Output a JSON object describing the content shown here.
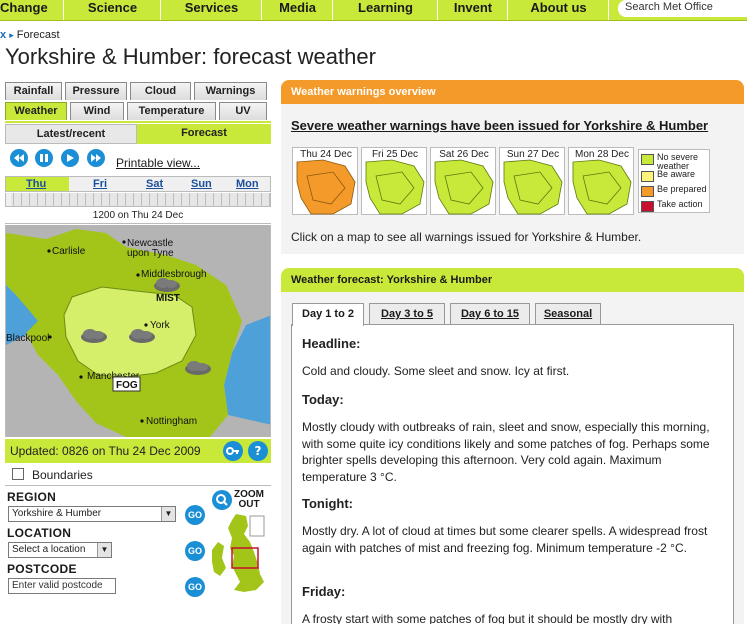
{
  "nav": {
    "items": [
      "Change",
      "Science",
      "Services",
      "Media",
      "Learning",
      "Invent",
      "About us"
    ],
    "search_placeholder": "Search Met Office"
  },
  "breadcrumb": {
    "close": "x",
    "current": "Forecast"
  },
  "page_title": "Yorkshire & Humber: forecast weather",
  "map_tabs_row1": [
    "Rainfall",
    "Pressure",
    "Cloud",
    "Warnings"
  ],
  "map_tabs_row2": [
    "Weather",
    "Wind",
    "Temperature",
    "UV"
  ],
  "active_map_tab": "Weather",
  "subtabs": {
    "latest": "Latest/recent",
    "forecast": "Forecast",
    "active": "Forecast"
  },
  "player": {
    "printable": "Printable view..."
  },
  "days": [
    "Thu",
    "Fri",
    "Sat",
    "Sun",
    "Mon"
  ],
  "selected_day": "Thu",
  "map_time": "1200 on Thu 24 Dec",
  "map_labels": {
    "carlisle": "Carlisle",
    "newcastle_1": "Newcastle",
    "newcastle_2": "upon Tyne",
    "middlesbrough": "Middlesbrough",
    "mist": "MIST",
    "york": "York",
    "blackpool": "Blackpool",
    "manchester": "Manchester",
    "fog": "FOG",
    "nottingham": "Nottingham"
  },
  "updated": "Updated: 0826 on Thu 24 Dec 2009",
  "help_icon": "?",
  "boundaries_label": "Boundaries",
  "boundaries_checked": false,
  "region": {
    "label": "REGION",
    "value": "Yorkshire & Humber"
  },
  "location": {
    "label": "LOCATION",
    "value": "Select a location"
  },
  "postcode": {
    "label": "POSTCODE",
    "placeholder": "Enter valid postcode"
  },
  "go_label": "GO",
  "zoom_out": {
    "line1": "ZOOM",
    "line2": "OUT"
  },
  "warnings": {
    "header": "Weather warnings overview",
    "headline": "Severe weather warnings have been issued for Yorkshire & Humber",
    "days": [
      {
        "label": "Thu 24 Dec",
        "level": "prepared"
      },
      {
        "label": "Fri 25 Dec",
        "level": "none"
      },
      {
        "label": "Sat 26 Dec",
        "level": "none"
      },
      {
        "label": "Sun 27 Dec",
        "level": "none"
      },
      {
        "label": "Mon 28 Dec",
        "level": "none"
      }
    ],
    "legend": [
      {
        "label_1": "No severe",
        "label_2": "weather",
        "color": "#c8e83a"
      },
      {
        "label_1": "Be aware",
        "label_2": "",
        "color": "#fff27a"
      },
      {
        "label_1": "Be prepared",
        "label_2": "",
        "color": "#f49a2a"
      },
      {
        "label_1": "Take action",
        "label_2": "",
        "color": "#c8102e"
      }
    ],
    "click_msg": "Click on a map to see all warnings issued for Yorkshire & Humber."
  },
  "forecast": {
    "header": "Weather forecast: Yorkshire & Humber",
    "tabs": [
      "Day 1 to 2",
      "Day 3 to 5",
      "Day 6 to 15",
      "Seasonal"
    ],
    "active_tab": "Day 1 to 2",
    "headline_title": "Headline:",
    "headline_text": "Cold and cloudy. Some sleet and snow. Icy at first.",
    "today_title": "Today:",
    "today_text": "Mostly cloudy with outbreaks of rain, sleet and snow, especially this morning, with some quite icy conditions likely and some patches of fog. Perhaps some brighter spells developing this afternoon. Very cold again. Maximum temperature 3 °C.",
    "tonight_title": "Tonight:",
    "tonight_text": "Mostly dry. A lot of cloud at times but some clearer spells. A widespread frost again with patches of mist and freezing fog. Minimum temperature -2 °C.",
    "friday_title": "Friday:",
    "friday_text": "A frosty start with some patches of fog but it should be mostly dry with"
  },
  "colors": {
    "lime": "#c8e83a",
    "orange": "#f49a2a",
    "link_blue": "#1a8fd6",
    "sea_blue": "#4ea0d8",
    "land_grey": "#b4b4b4"
  }
}
